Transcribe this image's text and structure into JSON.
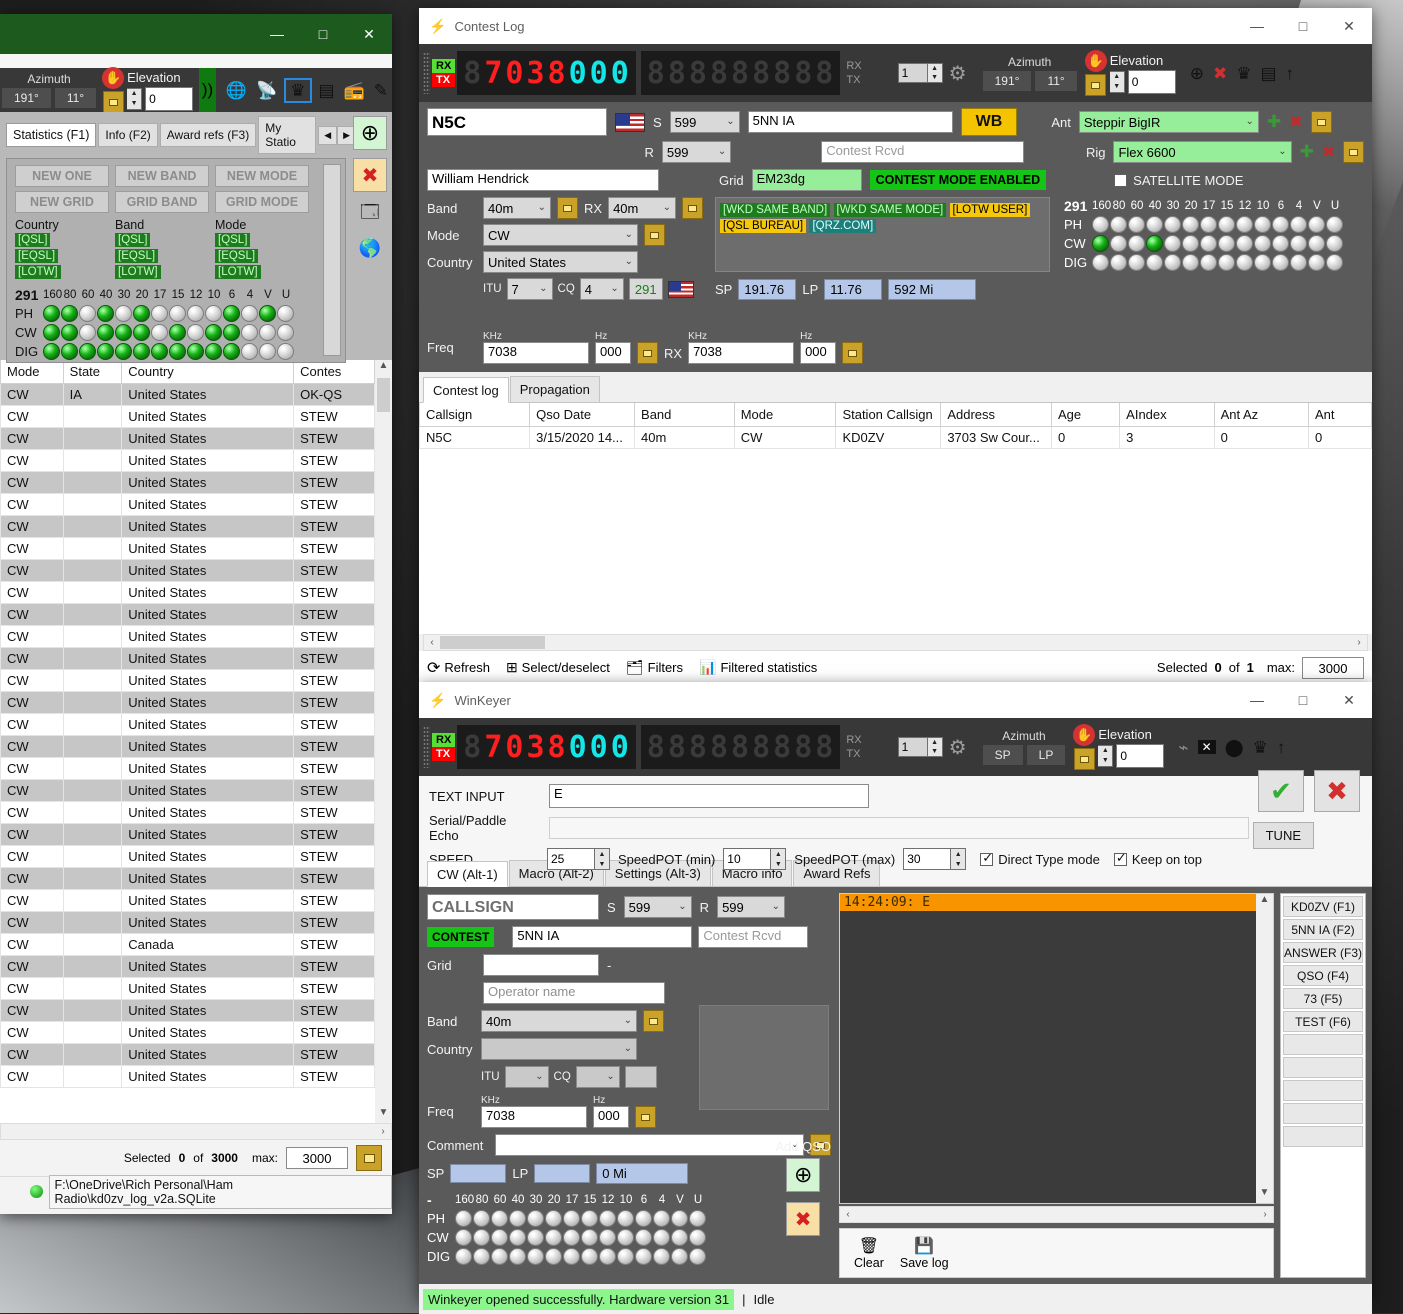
{
  "desktop": {},
  "statistics_window": {
    "titlebar": {
      "minimize": "—",
      "maximize": "□",
      "close": "✕"
    },
    "radiobar": {
      "azimuth_label": "Azimuth",
      "azimuth_value": "191°",
      "azimuth_value2": "11°",
      "elevation_label": "Elevation",
      "elevation_value": "0"
    },
    "tabs": [
      {
        "label": "Statistics (F1)",
        "active": true
      },
      {
        "label": "Info (F2)",
        "active": false
      },
      {
        "label": "Award refs (F3)",
        "active": false
      },
      {
        "label": "My Statio",
        "active": false
      }
    ],
    "stat_buttons": [
      "NEW ONE",
      "NEW BAND",
      "NEW MODE",
      "NEW GRID",
      "GRID BAND",
      "GRID MODE"
    ],
    "confirm_columns": [
      {
        "title": "Country",
        "tags": [
          "[QSL]",
          "[EQSL]",
          "[LOTW]"
        ]
      },
      {
        "title": "Band",
        "tags": [
          "[QSL]",
          "[EQSL]",
          "[LOTW]"
        ]
      },
      {
        "title": "Mode",
        "tags": [
          "[QSL]",
          "[EQSL]",
          "[LOTW]"
        ]
      }
    ],
    "led_panel": {
      "dxcc": "291",
      "bands": [
        "160",
        "80",
        "60",
        "40",
        "30",
        "20",
        "17",
        "15",
        "12",
        "10",
        "6",
        "4",
        "V",
        "U"
      ],
      "rows": [
        {
          "name": "PH",
          "on": [
            1,
            1,
            0,
            1,
            0,
            1,
            0,
            0,
            0,
            0,
            1,
            0,
            1,
            0
          ]
        },
        {
          "name": "CW",
          "on": [
            1,
            1,
            0,
            1,
            1,
            1,
            0,
            1,
            0,
            1,
            1,
            0,
            0,
            0
          ]
        },
        {
          "name": "DIG",
          "on": [
            1,
            1,
            1,
            1,
            1,
            1,
            1,
            1,
            1,
            1,
            1,
            0,
            0,
            0
          ]
        }
      ]
    },
    "table": {
      "columns": [
        "Mode",
        "State",
        "Country",
        "Contes"
      ],
      "rows": [
        [
          "CW",
          "IA",
          "United States",
          "OK-QS"
        ],
        [
          "CW",
          "",
          "United States",
          "STEW"
        ],
        [
          "CW",
          "",
          "United States",
          "STEW"
        ],
        [
          "CW",
          "",
          "United States",
          "STEW"
        ],
        [
          "CW",
          "",
          "United States",
          "STEW"
        ],
        [
          "CW",
          "",
          "United States",
          "STEW"
        ],
        [
          "CW",
          "",
          "United States",
          "STEW"
        ],
        [
          "CW",
          "",
          "United States",
          "STEW"
        ],
        [
          "CW",
          "",
          "United States",
          "STEW"
        ],
        [
          "CW",
          "",
          "United States",
          "STEW"
        ],
        [
          "CW",
          "",
          "United States",
          "STEW"
        ],
        [
          "CW",
          "",
          "United States",
          "STEW"
        ],
        [
          "CW",
          "",
          "United States",
          "STEW"
        ],
        [
          "CW",
          "",
          "United States",
          "STEW"
        ],
        [
          "CW",
          "",
          "United States",
          "STEW"
        ],
        [
          "CW",
          "",
          "United States",
          "STEW"
        ],
        [
          "CW",
          "",
          "United States",
          "STEW"
        ],
        [
          "CW",
          "",
          "United States",
          "STEW"
        ],
        [
          "CW",
          "",
          "United States",
          "STEW"
        ],
        [
          "CW",
          "",
          "United States",
          "STEW"
        ],
        [
          "CW",
          "",
          "United States",
          "STEW"
        ],
        [
          "CW",
          "",
          "United States",
          "STEW"
        ],
        [
          "CW",
          "",
          "United States",
          "STEW"
        ],
        [
          "CW",
          "",
          "United States",
          "STEW"
        ],
        [
          "CW",
          "",
          "United States",
          "STEW"
        ],
        [
          "CW",
          "",
          "Canada",
          "STEW"
        ],
        [
          "CW",
          "",
          "United States",
          "STEW"
        ],
        [
          "CW",
          "",
          "United States",
          "STEW"
        ],
        [
          "CW",
          "",
          "United States",
          "STEW"
        ],
        [
          "CW",
          "",
          "United States",
          "STEW"
        ],
        [
          "CW",
          "",
          "United States",
          "STEW"
        ],
        [
          "CW",
          "",
          "United States",
          "STEW"
        ]
      ]
    },
    "footer": {
      "selected_label": "Selected",
      "selected_count": "0",
      "of_label": "of",
      "total": "3000",
      "max_label": "max:",
      "max_value": "3000"
    },
    "status": {
      "db_path": "F:\\OneDrive\\Rich Personal\\Ham Radio\\kd0zv_log_v2a.SQLite"
    }
  },
  "contest_log_window": {
    "title": "Contest Log",
    "titlebar": {
      "minimize": "—",
      "maximize": "□",
      "close": "✕"
    },
    "radiobar": {
      "freq_digits": [
        {
          "ch": "8",
          "state": "off"
        },
        {
          "ch": "7",
          "state": "red"
        },
        {
          "ch": "0",
          "state": "red"
        },
        {
          "ch": "3",
          "state": "red"
        },
        {
          "ch": "8",
          "state": "red"
        },
        {
          "ch": "0",
          "state": "cyan"
        },
        {
          "ch": "0",
          "state": "cyan"
        },
        {
          "ch": "0",
          "state": "cyan"
        }
      ],
      "rx_label": "RX",
      "tx_label": "TX",
      "vfo_num": "1",
      "azimuth_label": "Azimuth",
      "azimuth_value": "191°",
      "azimuth_value2": "11°",
      "elevation_label": "Elevation",
      "elevation_value": "0"
    },
    "form": {
      "callsign": "N5C",
      "name": "William Hendrick",
      "s_label": "S",
      "s_value": "599",
      "r_label": "R",
      "r_value": "599",
      "sent_exchange": "5NN IA",
      "rcvd_placeholder": "Contest Rcvd",
      "wb_badge": "WB",
      "grid_label": "Grid",
      "grid_value": "EM23dg",
      "contest_mode_banner": "CONTEST MODE ENABLED",
      "flags": [
        "[WKD SAME BAND]",
        "[WKD SAME MODE]",
        "[LOTW USER]",
        "[QSL BUREAU]",
        "[QRZ.COM]"
      ],
      "band_label": "Band",
      "band_value": "40m",
      "rx_label": "RX",
      "rx_band_value": "40m",
      "mode_label": "Mode",
      "mode_value": "CW",
      "country_label": "Country",
      "country_value": "United States",
      "itu_label": "ITU",
      "itu_value": "7",
      "cq_label": "CQ",
      "cq_value": "4",
      "dxcc_value": "291",
      "sp_label": "SP",
      "sp_value": "191.76",
      "lp_label": "LP",
      "lp_value": "11.76",
      "distance": "592 Mi",
      "freq_label": "Freq",
      "khz_label": "KHz",
      "hz_label": "Hz",
      "freq_khz": "7038",
      "freq_hz": "000",
      "rx_freq_label": "RX",
      "rx_freq_khz": "7038",
      "rx_freq_hz": "000",
      "ant_label": "Ant",
      "ant_value": "Steppir BigIR",
      "rig_label": "Rig",
      "rig_value": "Flex 6600",
      "satellite_mode": "SATELLITE MODE"
    },
    "led_panel": {
      "dxcc": "291",
      "bands": [
        "160",
        "80",
        "60",
        "40",
        "30",
        "20",
        "17",
        "15",
        "12",
        "10",
        "6",
        "4",
        "V",
        "U"
      ],
      "rows": [
        {
          "name": "PH",
          "on": [
            0,
            0,
            0,
            0,
            0,
            0,
            0,
            0,
            0,
            0,
            0,
            0,
            0,
            0
          ]
        },
        {
          "name": "CW",
          "on": [
            1,
            0,
            0,
            1,
            0,
            0,
            0,
            0,
            0,
            0,
            0,
            0,
            0,
            0
          ]
        },
        {
          "name": "DIG",
          "on": [
            0,
            0,
            0,
            0,
            0,
            0,
            0,
            0,
            0,
            0,
            0,
            0,
            0,
            0
          ]
        }
      ]
    },
    "tabs": [
      {
        "label": "Contest log",
        "active": true
      },
      {
        "label": "Propagation",
        "active": false
      }
    ],
    "table": {
      "columns": [
        "Callsign",
        "Qso Date",
        "Band",
        "Mode",
        "Station Callsign",
        "Address",
        "Age",
        "AIndex",
        "Ant Az",
        "Ant"
      ],
      "rows": [
        [
          "N5C",
          "3/15/2020 14...",
          "40m",
          "CW",
          "KD0ZV",
          "3703 Sw Cour...",
          "0",
          "3",
          "0",
          "0"
        ]
      ]
    },
    "toolbar": {
      "refresh": "Refresh",
      "select_deselect": "Select/deselect",
      "filters": "Filters",
      "filtered_statistics": "Filtered statistics",
      "selected_label": "Selected",
      "selected_count": "0",
      "of_label": "of",
      "total": "1",
      "max_label": "max:",
      "max_value": "3000"
    }
  },
  "winkeyer_window": {
    "title": "WinKeyer",
    "titlebar": {
      "minimize": "—",
      "maximize": "□",
      "close": "✕"
    },
    "radiobar": {
      "freq_digits": [
        {
          "ch": "8",
          "state": "off"
        },
        {
          "ch": "7",
          "state": "red"
        },
        {
          "ch": "0",
          "state": "red"
        },
        {
          "ch": "3",
          "state": "red"
        },
        {
          "ch": "8",
          "state": "red"
        },
        {
          "ch": "0",
          "state": "cyan"
        },
        {
          "ch": "0",
          "state": "cyan"
        },
        {
          "ch": "0",
          "state": "cyan"
        }
      ],
      "rx_label": "RX",
      "tx_label": "TX",
      "vfo_num": "1",
      "azimuth_label": "Azimuth",
      "sp_label": "SP",
      "lp_label": "LP",
      "elevation_label": "Elevation",
      "elevation_value": "0"
    },
    "controls": {
      "text_input_label": "TEXT INPUT",
      "text_input_value": "E",
      "serial_echo_label": "Serial/Paddle Echo",
      "serial_echo_value": "",
      "speed_label": "SPEED",
      "speed_value": "25",
      "speedpot_min_label": "SpeedPOT (min)",
      "speedpot_min_value": "10",
      "speedpot_max_label": "SpeedPOT (max)",
      "speedpot_max_value": "30",
      "direct_type_label": "Direct Type mode",
      "direct_type_checked": true,
      "keep_on_top_label": "Keep on top",
      "keep_on_top_checked": true,
      "tune_label": "TUNE"
    },
    "tabs": [
      {
        "label": "CW (Alt-1)",
        "active": true
      },
      {
        "label": "Macro (Alt-2)",
        "active": false
      },
      {
        "label": "Settings (Alt-3)",
        "active": false
      },
      {
        "label": "Macro info",
        "active": false
      },
      {
        "label": "Award Refs",
        "active": false
      }
    ],
    "form": {
      "callsign_placeholder": "CALLSIGN",
      "s_label": "S",
      "s_value": "599",
      "r_label": "R",
      "r_value": "599",
      "contest_badge": "CONTEST",
      "sent_exchange": "5NN IA",
      "rcvd_placeholder": "Contest Rcvd",
      "grid_label": "Grid",
      "grid_value": "",
      "grid_dash": "-",
      "operator_placeholder": "Operator name",
      "band_label": "Band",
      "band_value": "40m",
      "country_label": "Country",
      "country_value": "",
      "itu_label": "ITU",
      "itu_value": "",
      "cq_label": "CQ",
      "cq_value": "",
      "freq_label": "Freq",
      "khz_label": "KHz",
      "hz_label": "Hz",
      "freq_khz": "7038",
      "freq_hz": "000",
      "comment_label": "Comment",
      "comment_value": "",
      "sp_label": "SP",
      "sp_value": "",
      "lp_label": "LP",
      "lp_value": "",
      "distance": "0 Mi",
      "add_qso_label": "Add QSO"
    },
    "led_panel": {
      "dxcc": "-",
      "bands": [
        "160",
        "80",
        "60",
        "40",
        "30",
        "20",
        "17",
        "15",
        "12",
        "10",
        "6",
        "4",
        "V",
        "U"
      ],
      "rows": [
        {
          "name": "PH",
          "on": [
            0,
            0,
            0,
            0,
            0,
            0,
            0,
            0,
            0,
            0,
            0,
            0,
            0,
            0
          ]
        },
        {
          "name": "CW",
          "on": [
            0,
            0,
            0,
            0,
            0,
            0,
            0,
            0,
            0,
            0,
            0,
            0,
            0,
            0
          ]
        },
        {
          "name": "DIG",
          "on": [
            0,
            0,
            0,
            0,
            0,
            0,
            0,
            0,
            0,
            0,
            0,
            0,
            0,
            0
          ]
        }
      ]
    },
    "console": {
      "lines": [
        "14:24:09: E"
      ]
    },
    "macro_buttons": [
      "KD0ZV (F1)",
      "5NN IA (F2)",
      "ANSWER (F3)",
      "QSO (F4)",
      "73 (F5)",
      "TEST (F6)",
      "",
      "",
      "",
      "",
      ""
    ],
    "log_toolbar": {
      "clear": "Clear",
      "save_log": "Save log"
    },
    "statusbar": {
      "message": "Winkeyer opened successfully. Hardware version 31",
      "separator": "|",
      "state": "Idle"
    }
  }
}
